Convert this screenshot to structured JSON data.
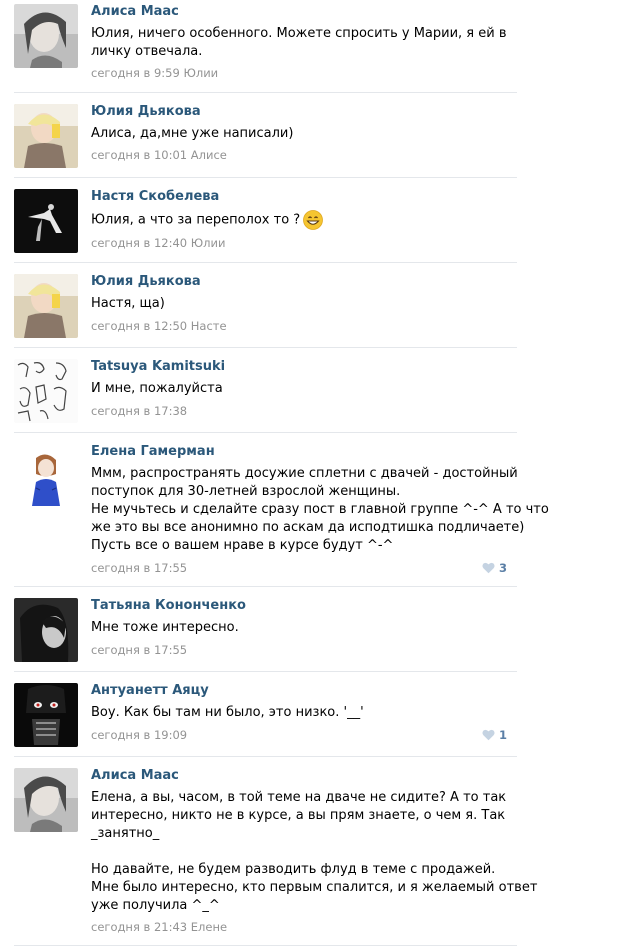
{
  "comments": [
    {
      "author": "Алиса Маас",
      "lines": [
        "Юлия, ничего особенного. Можете спросить у Марии, я ей в",
        "личку отвечала."
      ],
      "date": "сегодня в 9:59",
      "reply_to": "Юлии",
      "avatar": "avatar-alisa"
    },
    {
      "author": "Юлия Дьякова",
      "lines": [
        "Алиса, да,мне уже написали)"
      ],
      "date": "сегодня в 10:01",
      "reply_to": "Алисе",
      "avatar": "avatar-yulia"
    },
    {
      "author": "Настя Скобелева",
      "lines": [
        "Юлия, а что за переполох то ?"
      ],
      "date": "сегодня в 12:40",
      "reply_to": "Юлии",
      "avatar": "avatar-nastya",
      "emoji": "grinning-emoji"
    },
    {
      "author": "Юлия Дьякова",
      "lines": [
        "Настя, ща)"
      ],
      "date": "сегодня в 12:50",
      "reply_to": "Насте",
      "avatar": "avatar-yulia"
    },
    {
      "author": "Tatsuya Kamitsuki",
      "lines": [
        "И мне, пожалуйста"
      ],
      "date": "сегодня в 17:38",
      "reply_to": "",
      "avatar": "avatar-tatsuya"
    },
    {
      "author": "Елена Гамерман",
      "lines": [
        "Ммм, распространять досужие сплетни с двачей - достойный",
        "поступок для 30-летней взрослой женщины.",
        "Не мучьтесь и сделайте сразу пост в главной группе ^-^ А то что",
        "же это вы все анонимно по аскам да исподтишка подличаете)",
        "Пусть все о вашем нраве в курсе будут ^-^"
      ],
      "date": "сегодня в 17:55",
      "reply_to": "",
      "avatar": "avatar-elena",
      "likes": "3"
    },
    {
      "author": "Татьяна Кононченко",
      "lines": [
        "Мне тоже интересно."
      ],
      "date": "сегодня в 17:55",
      "reply_to": "",
      "avatar": "avatar-tatyana"
    },
    {
      "author": "Антуанетт Аяцу",
      "lines": [
        "Воу. Как бы там ни было, это низко. '__'"
      ],
      "date": "сегодня в 19:09",
      "reply_to": "",
      "avatar": "avatar-antuanett",
      "likes": "1"
    },
    {
      "author": "Алиса Маас",
      "lines": [
        "Елена, а вы, часом, в той теме на дваче не сидите? А то так",
        "интересно, никто не в курсе, а вы прям знаете, о чем я. Так",
        "_занятно_",
        "",
        "Но давайте, не будем разводить флуд в теме с продажей.",
        "Мне было интересно, кто первым спалится, и я желаемый ответ",
        "уже получила ^_^"
      ],
      "date": "сегодня в 21:43",
      "reply_to": "Елене",
      "avatar": "avatar-alisa"
    }
  ],
  "colors": {
    "author": "#2b587a",
    "meta": "#939393",
    "separator": "#e4e7eb",
    "like": "#5b7fa6"
  }
}
